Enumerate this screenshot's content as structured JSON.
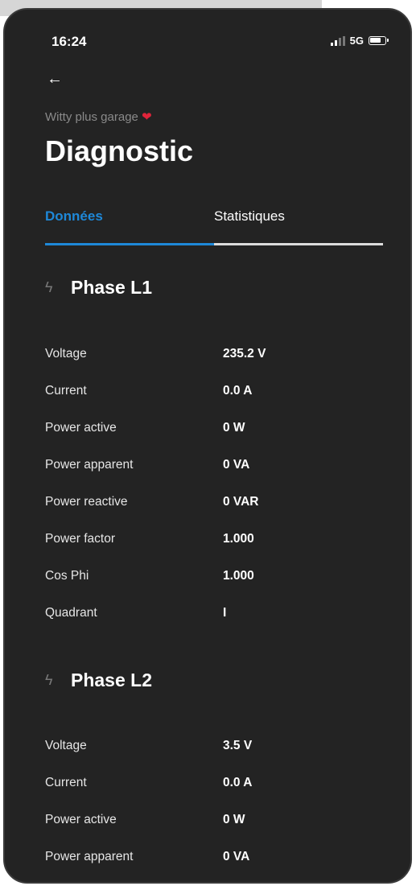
{
  "status_bar": {
    "time": "16:24",
    "network": "5G"
  },
  "header": {
    "subtitle": "Witty plus garage",
    "subtitle_emoji": "❤",
    "title": "Diagnostic"
  },
  "tabs": [
    {
      "label": "Données",
      "active": true
    },
    {
      "label": "Statistiques",
      "active": false
    }
  ],
  "colors": {
    "accent": "#1e88d8",
    "background": "#232323",
    "heart": "#e0243a"
  },
  "sections": [
    {
      "title": "Phase L1",
      "icon": "bolt-icon",
      "rows": [
        {
          "label": "Voltage",
          "value": "235.2 V"
        },
        {
          "label": "Current",
          "value": "0.0 A"
        },
        {
          "label": "Power active",
          "value": "0 W"
        },
        {
          "label": "Power apparent",
          "value": "0 VA"
        },
        {
          "label": "Power reactive",
          "value": "0 VAR"
        },
        {
          "label": "Power factor",
          "value": "1.000"
        },
        {
          "label": "Cos Phi",
          "value": "1.000"
        },
        {
          "label": "Quadrant",
          "value": "I"
        }
      ]
    },
    {
      "title": "Phase L2",
      "icon": "bolt-icon",
      "rows": [
        {
          "label": "Voltage",
          "value": "3.5 V"
        },
        {
          "label": "Current",
          "value": "0.0 A"
        },
        {
          "label": "Power active",
          "value": "0 W"
        },
        {
          "label": "Power apparent",
          "value": "0 VA"
        }
      ]
    }
  ]
}
